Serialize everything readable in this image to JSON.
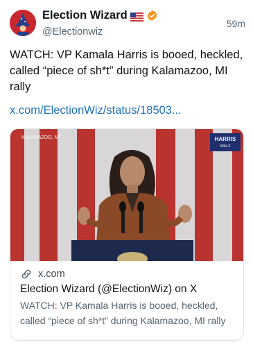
{
  "author": {
    "name": "Election Wizard",
    "handle": "@Electionwiz",
    "flag_icon": "us-flag-icon",
    "verified_icon": "verified-badge-icon",
    "verified_color": "#f7931a"
  },
  "post": {
    "time": "59m",
    "text": "WATCH: VP Kamala Harris is booed, heckled, called “piece of sh*t” during Kalamazoo, MI rally",
    "link": "x.com/ElectionWiz/status/18503..."
  },
  "card": {
    "image_caption_top": "KALAMAZOO, MI",
    "image_sign_line1": "HARRIS",
    "image_sign_line2": "WALZ",
    "domain_icon": "link-icon",
    "domain": "x.com",
    "title": "Election Wizard (@ElectionWiz) on X",
    "description": "WATCH: VP Kamala Harris is booed, heckled, called “piece of sh*t” during Kalamazoo, MI rally"
  },
  "colors": {
    "link": "#1d70b8",
    "avatar_bg": "#c8282d",
    "stripe_red": "#b9342f"
  }
}
